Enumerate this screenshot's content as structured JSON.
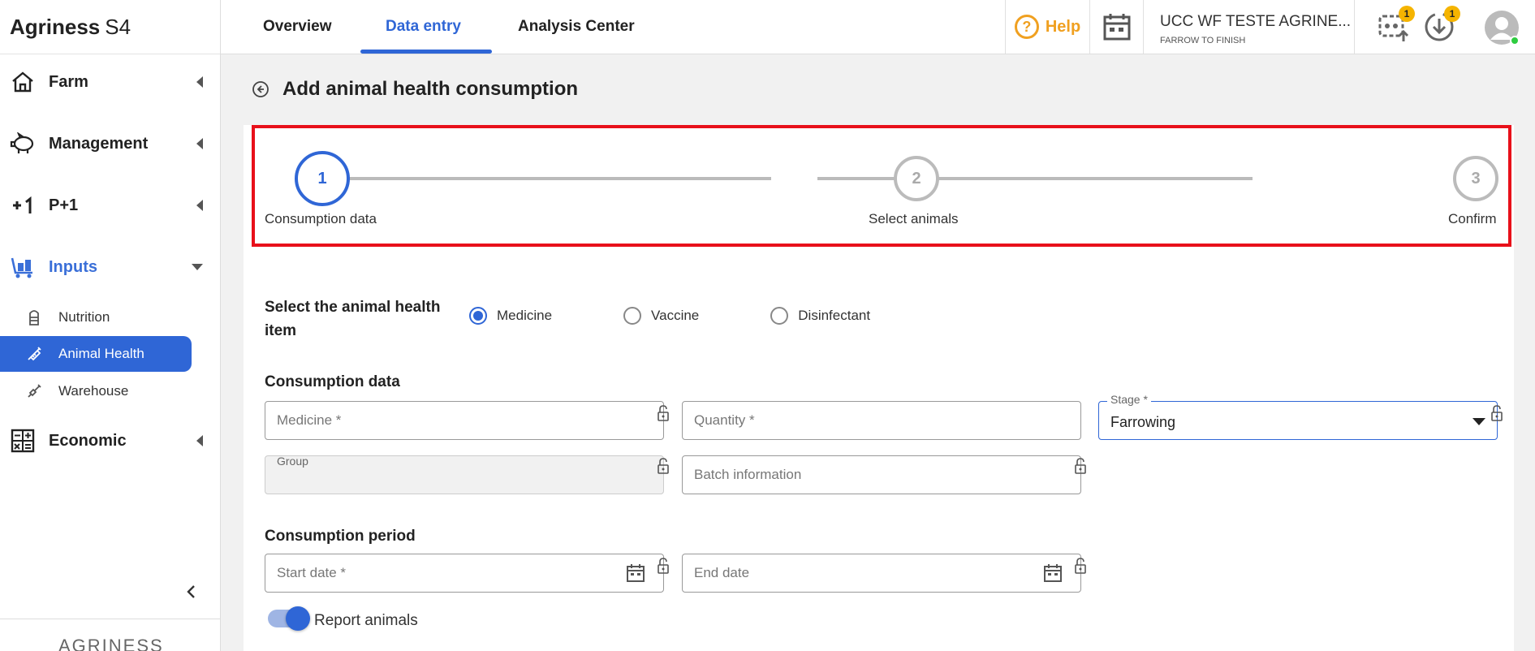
{
  "brand": {
    "name": "Agriness",
    "suffix": "S4"
  },
  "sidebar": {
    "items": [
      {
        "label": "Farm"
      },
      {
        "label": "Management"
      },
      {
        "label": "P+1"
      },
      {
        "label": "Inputs"
      },
      {
        "label": "Economic"
      }
    ],
    "subitems": [
      {
        "label": "Nutrition"
      },
      {
        "label": "Animal Health"
      },
      {
        "label": "Warehouse"
      }
    ],
    "footer_logo": "AGRINESS"
  },
  "topbar": {
    "tabs": [
      {
        "label": "Overview"
      },
      {
        "label": "Data entry"
      },
      {
        "label": "Analysis Center"
      }
    ],
    "help_label": "Help",
    "farm_name": "UCC WF TESTE AGRINE...",
    "farm_type": "FARROW TO FINISH",
    "badge_sync": "1",
    "badge_download": "1"
  },
  "page": {
    "title": "Add animal health consumption"
  },
  "stepper": {
    "steps": [
      {
        "number": "1",
        "label": "Consumption data"
      },
      {
        "number": "2",
        "label": "Select animals"
      },
      {
        "number": "3",
        "label": "Confirm"
      }
    ]
  },
  "form": {
    "item_section_label": "Select the animal health item",
    "radios": [
      {
        "label": "Medicine",
        "checked": true
      },
      {
        "label": "Vaccine",
        "checked": false
      },
      {
        "label": "Disinfectant",
        "checked": false
      }
    ],
    "consumption_data_label": "Consumption data",
    "medicine_placeholder": "Medicine *",
    "quantity_placeholder": "Quantity *",
    "stage_label": "Stage *",
    "stage_value": "Farrowing",
    "group_label": "Group",
    "batch_placeholder": "Batch information",
    "period_label": "Consumption period",
    "start_date_placeholder": "Start date *",
    "end_date_placeholder": "End date",
    "report_animals_label": "Report animals"
  },
  "colors": {
    "accent": "#2f66d6",
    "help": "#f0a020",
    "highlight": "#e8101a"
  }
}
